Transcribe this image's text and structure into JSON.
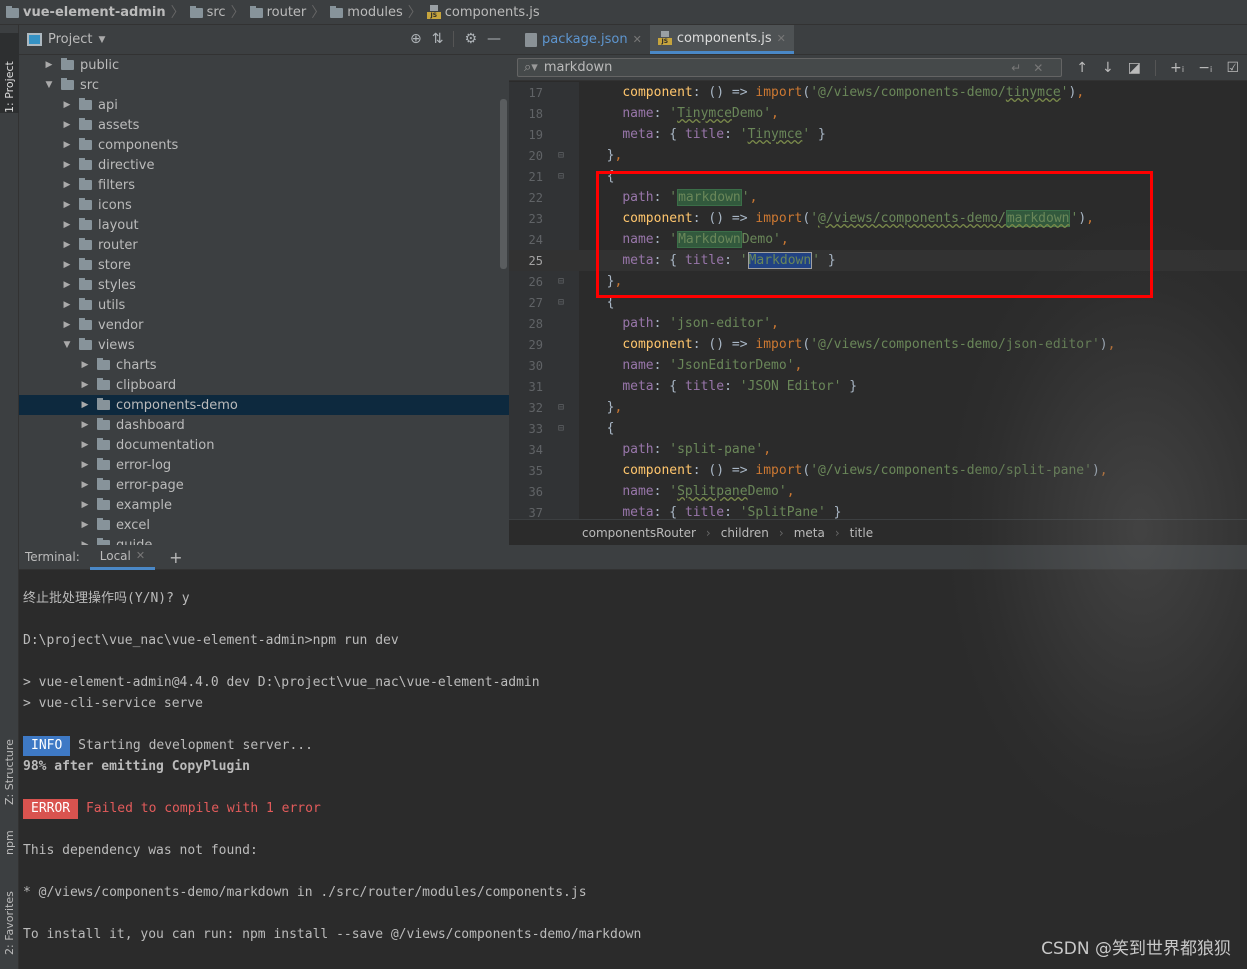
{
  "navbar": {
    "crumbs": [
      "vue-element-admin",
      "src",
      "router",
      "modules",
      "components.js"
    ]
  },
  "left_strip": {
    "top": "1: Project",
    "bottom": [
      "Z: Structure",
      "npm",
      "2: Favorites"
    ]
  },
  "project": {
    "title": "Project",
    "tree": [
      {
        "label": "public",
        "depth": 1,
        "expanded": false
      },
      {
        "label": "src",
        "depth": 1,
        "expanded": true
      },
      {
        "label": "api",
        "depth": 2,
        "expanded": false
      },
      {
        "label": "assets",
        "depth": 2,
        "expanded": false
      },
      {
        "label": "components",
        "depth": 2,
        "expanded": false
      },
      {
        "label": "directive",
        "depth": 2,
        "expanded": false
      },
      {
        "label": "filters",
        "depth": 2,
        "expanded": false
      },
      {
        "label": "icons",
        "depth": 2,
        "expanded": false
      },
      {
        "label": "layout",
        "depth": 2,
        "expanded": false
      },
      {
        "label": "router",
        "depth": 2,
        "expanded": false
      },
      {
        "label": "store",
        "depth": 2,
        "expanded": false
      },
      {
        "label": "styles",
        "depth": 2,
        "expanded": false
      },
      {
        "label": "utils",
        "depth": 2,
        "expanded": false
      },
      {
        "label": "vendor",
        "depth": 2,
        "expanded": false
      },
      {
        "label": "views",
        "depth": 2,
        "expanded": true
      },
      {
        "label": "charts",
        "depth": 3,
        "expanded": false
      },
      {
        "label": "clipboard",
        "depth": 3,
        "expanded": false
      },
      {
        "label": "components-demo",
        "depth": 3,
        "expanded": false,
        "selected": true
      },
      {
        "label": "dashboard",
        "depth": 3,
        "expanded": false
      },
      {
        "label": "documentation",
        "depth": 3,
        "expanded": false
      },
      {
        "label": "error-log",
        "depth": 3,
        "expanded": false
      },
      {
        "label": "error-page",
        "depth": 3,
        "expanded": false
      },
      {
        "label": "example",
        "depth": 3,
        "expanded": false
      },
      {
        "label": "excel",
        "depth": 3,
        "expanded": false
      },
      {
        "label": "guide",
        "depth": 3,
        "expanded": false
      }
    ]
  },
  "editor": {
    "tabs": [
      {
        "label": "package.json",
        "active": false
      },
      {
        "label": "components.js",
        "active": true
      }
    ],
    "find": {
      "value": "markdown"
    },
    "current_line": 25,
    "lines": [
      {
        "n": 17,
        "text": "component: () => import('@/views/components-demo/tinymce'),"
      },
      {
        "n": 18,
        "text": "name: 'TinymceDemo',"
      },
      {
        "n": 19,
        "text": "meta: { title: 'Tinymce' }"
      },
      {
        "n": 20,
        "text": "},"
      },
      {
        "n": 21,
        "text": "{"
      },
      {
        "n": 22,
        "text": "path: 'markdown',"
      },
      {
        "n": 23,
        "text": "component: () => import('@/views/components-demo/markdown'),"
      },
      {
        "n": 24,
        "text": "name: 'MarkdownDemo',"
      },
      {
        "n": 25,
        "text": "meta: { title: 'Markdown' }"
      },
      {
        "n": 26,
        "text": "},"
      },
      {
        "n": 27,
        "text": "{"
      },
      {
        "n": 28,
        "text": "path: 'json-editor',"
      },
      {
        "n": 29,
        "text": "component: () => import('@/views/components-demo/json-editor'),"
      },
      {
        "n": 30,
        "text": "name: 'JsonEditorDemo',"
      },
      {
        "n": 31,
        "text": "meta: { title: 'JSON Editor' }"
      },
      {
        "n": 32,
        "text": "},"
      },
      {
        "n": 33,
        "text": "{"
      },
      {
        "n": 34,
        "text": "path: 'split-pane',"
      },
      {
        "n": 35,
        "text": "component: () => import('@/views/components-demo/split-pane'),"
      },
      {
        "n": 36,
        "text": "name: 'SplitpaneDemo',"
      },
      {
        "n": 37,
        "text": "meta: { title: 'SplitPane' }"
      }
    ],
    "breadcrumb": [
      "componentsRouter",
      "children",
      "meta",
      "title"
    ]
  },
  "terminal": {
    "label": "Terminal:",
    "tab": "Local",
    "lines": [
      {
        "type": "text",
        "text": "终止批处理操作吗(Y/N)? y"
      },
      {
        "type": "blank"
      },
      {
        "type": "text",
        "text": "D:\\project\\vue_nac\\vue-element-admin>npm run dev"
      },
      {
        "type": "blank"
      },
      {
        "type": "text",
        "text": "> vue-element-admin@4.4.0 dev D:\\project\\vue_nac\\vue-element-admin"
      },
      {
        "type": "text",
        "text": "> vue-cli-service serve"
      },
      {
        "type": "blank"
      },
      {
        "type": "badge",
        "badge": "INFO",
        "text": "Starting development server..."
      },
      {
        "type": "bold",
        "text": "98% after emitting CopyPlugin"
      },
      {
        "type": "blank"
      },
      {
        "type": "error",
        "badge": "ERROR",
        "text": "Failed to compile with 1 error"
      },
      {
        "type": "blank"
      },
      {
        "type": "text",
        "text": "This dependency was not found:"
      },
      {
        "type": "blank"
      },
      {
        "type": "text",
        "text": "* @/views/components-demo/markdown in ./src/router/modules/components.js"
      },
      {
        "type": "blank"
      },
      {
        "type": "text",
        "text": "To install it, you can run: npm install --save @/views/components-demo/markdown"
      }
    ]
  },
  "watermark": "CSDN @笑到世界都狼狈",
  "colors": {
    "highlight_box": "#ff0000",
    "info": "#3e79c5",
    "error": "#d9534f",
    "selection": "#0d293e"
  }
}
